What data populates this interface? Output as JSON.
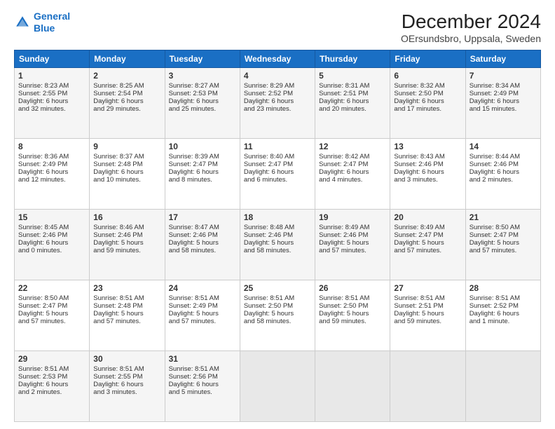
{
  "header": {
    "logo_line1": "General",
    "logo_line2": "Blue",
    "title": "December 2024",
    "subtitle": "OErsundsbro, Uppsala, Sweden"
  },
  "days_of_week": [
    "Sunday",
    "Monday",
    "Tuesday",
    "Wednesday",
    "Thursday",
    "Friday",
    "Saturday"
  ],
  "weeks": [
    [
      {
        "day": "1",
        "lines": [
          "Sunrise: 8:23 AM",
          "Sunset: 2:55 PM",
          "Daylight: 6 hours",
          "and 32 minutes."
        ]
      },
      {
        "day": "2",
        "lines": [
          "Sunrise: 8:25 AM",
          "Sunset: 2:54 PM",
          "Daylight: 6 hours",
          "and 29 minutes."
        ]
      },
      {
        "day": "3",
        "lines": [
          "Sunrise: 8:27 AM",
          "Sunset: 2:53 PM",
          "Daylight: 6 hours",
          "and 25 minutes."
        ]
      },
      {
        "day": "4",
        "lines": [
          "Sunrise: 8:29 AM",
          "Sunset: 2:52 PM",
          "Daylight: 6 hours",
          "and 23 minutes."
        ]
      },
      {
        "day": "5",
        "lines": [
          "Sunrise: 8:31 AM",
          "Sunset: 2:51 PM",
          "Daylight: 6 hours",
          "and 20 minutes."
        ]
      },
      {
        "day": "6",
        "lines": [
          "Sunrise: 8:32 AM",
          "Sunset: 2:50 PM",
          "Daylight: 6 hours",
          "and 17 minutes."
        ]
      },
      {
        "day": "7",
        "lines": [
          "Sunrise: 8:34 AM",
          "Sunset: 2:49 PM",
          "Daylight: 6 hours",
          "and 15 minutes."
        ]
      }
    ],
    [
      {
        "day": "8",
        "lines": [
          "Sunrise: 8:36 AM",
          "Sunset: 2:49 PM",
          "Daylight: 6 hours",
          "and 12 minutes."
        ]
      },
      {
        "day": "9",
        "lines": [
          "Sunrise: 8:37 AM",
          "Sunset: 2:48 PM",
          "Daylight: 6 hours",
          "and 10 minutes."
        ]
      },
      {
        "day": "10",
        "lines": [
          "Sunrise: 8:39 AM",
          "Sunset: 2:47 PM",
          "Daylight: 6 hours",
          "and 8 minutes."
        ]
      },
      {
        "day": "11",
        "lines": [
          "Sunrise: 8:40 AM",
          "Sunset: 2:47 PM",
          "Daylight: 6 hours",
          "and 6 minutes."
        ]
      },
      {
        "day": "12",
        "lines": [
          "Sunrise: 8:42 AM",
          "Sunset: 2:47 PM",
          "Daylight: 6 hours",
          "and 4 minutes."
        ]
      },
      {
        "day": "13",
        "lines": [
          "Sunrise: 8:43 AM",
          "Sunset: 2:46 PM",
          "Daylight: 6 hours",
          "and 3 minutes."
        ]
      },
      {
        "day": "14",
        "lines": [
          "Sunrise: 8:44 AM",
          "Sunset: 2:46 PM",
          "Daylight: 6 hours",
          "and 2 minutes."
        ]
      }
    ],
    [
      {
        "day": "15",
        "lines": [
          "Sunrise: 8:45 AM",
          "Sunset: 2:46 PM",
          "Daylight: 6 hours",
          "and 0 minutes."
        ]
      },
      {
        "day": "16",
        "lines": [
          "Sunrise: 8:46 AM",
          "Sunset: 2:46 PM",
          "Daylight: 5 hours",
          "and 59 minutes."
        ]
      },
      {
        "day": "17",
        "lines": [
          "Sunrise: 8:47 AM",
          "Sunset: 2:46 PM",
          "Daylight: 5 hours",
          "and 58 minutes."
        ]
      },
      {
        "day": "18",
        "lines": [
          "Sunrise: 8:48 AM",
          "Sunset: 2:46 PM",
          "Daylight: 5 hours",
          "and 58 minutes."
        ]
      },
      {
        "day": "19",
        "lines": [
          "Sunrise: 8:49 AM",
          "Sunset: 2:46 PM",
          "Daylight: 5 hours",
          "and 57 minutes."
        ]
      },
      {
        "day": "20",
        "lines": [
          "Sunrise: 8:49 AM",
          "Sunset: 2:47 PM",
          "Daylight: 5 hours",
          "and 57 minutes."
        ]
      },
      {
        "day": "21",
        "lines": [
          "Sunrise: 8:50 AM",
          "Sunset: 2:47 PM",
          "Daylight: 5 hours",
          "and 57 minutes."
        ]
      }
    ],
    [
      {
        "day": "22",
        "lines": [
          "Sunrise: 8:50 AM",
          "Sunset: 2:47 PM",
          "Daylight: 5 hours",
          "and 57 minutes."
        ]
      },
      {
        "day": "23",
        "lines": [
          "Sunrise: 8:51 AM",
          "Sunset: 2:48 PM",
          "Daylight: 5 hours",
          "and 57 minutes."
        ]
      },
      {
        "day": "24",
        "lines": [
          "Sunrise: 8:51 AM",
          "Sunset: 2:49 PM",
          "Daylight: 5 hours",
          "and 57 minutes."
        ]
      },
      {
        "day": "25",
        "lines": [
          "Sunrise: 8:51 AM",
          "Sunset: 2:50 PM",
          "Daylight: 5 hours",
          "and 58 minutes."
        ]
      },
      {
        "day": "26",
        "lines": [
          "Sunrise: 8:51 AM",
          "Sunset: 2:50 PM",
          "Daylight: 5 hours",
          "and 59 minutes."
        ]
      },
      {
        "day": "27",
        "lines": [
          "Sunrise: 8:51 AM",
          "Sunset: 2:51 PM",
          "Daylight: 5 hours",
          "and 59 minutes."
        ]
      },
      {
        "day": "28",
        "lines": [
          "Sunrise: 8:51 AM",
          "Sunset: 2:52 PM",
          "Daylight: 6 hours",
          "and 1 minute."
        ]
      }
    ],
    [
      {
        "day": "29",
        "lines": [
          "Sunrise: 8:51 AM",
          "Sunset: 2:53 PM",
          "Daylight: 6 hours",
          "and 2 minutes."
        ]
      },
      {
        "day": "30",
        "lines": [
          "Sunrise: 8:51 AM",
          "Sunset: 2:55 PM",
          "Daylight: 6 hours",
          "and 3 minutes."
        ]
      },
      {
        "day": "31",
        "lines": [
          "Sunrise: 8:51 AM",
          "Sunset: 2:56 PM",
          "Daylight: 6 hours",
          "and 5 minutes."
        ]
      },
      null,
      null,
      null,
      null
    ]
  ]
}
